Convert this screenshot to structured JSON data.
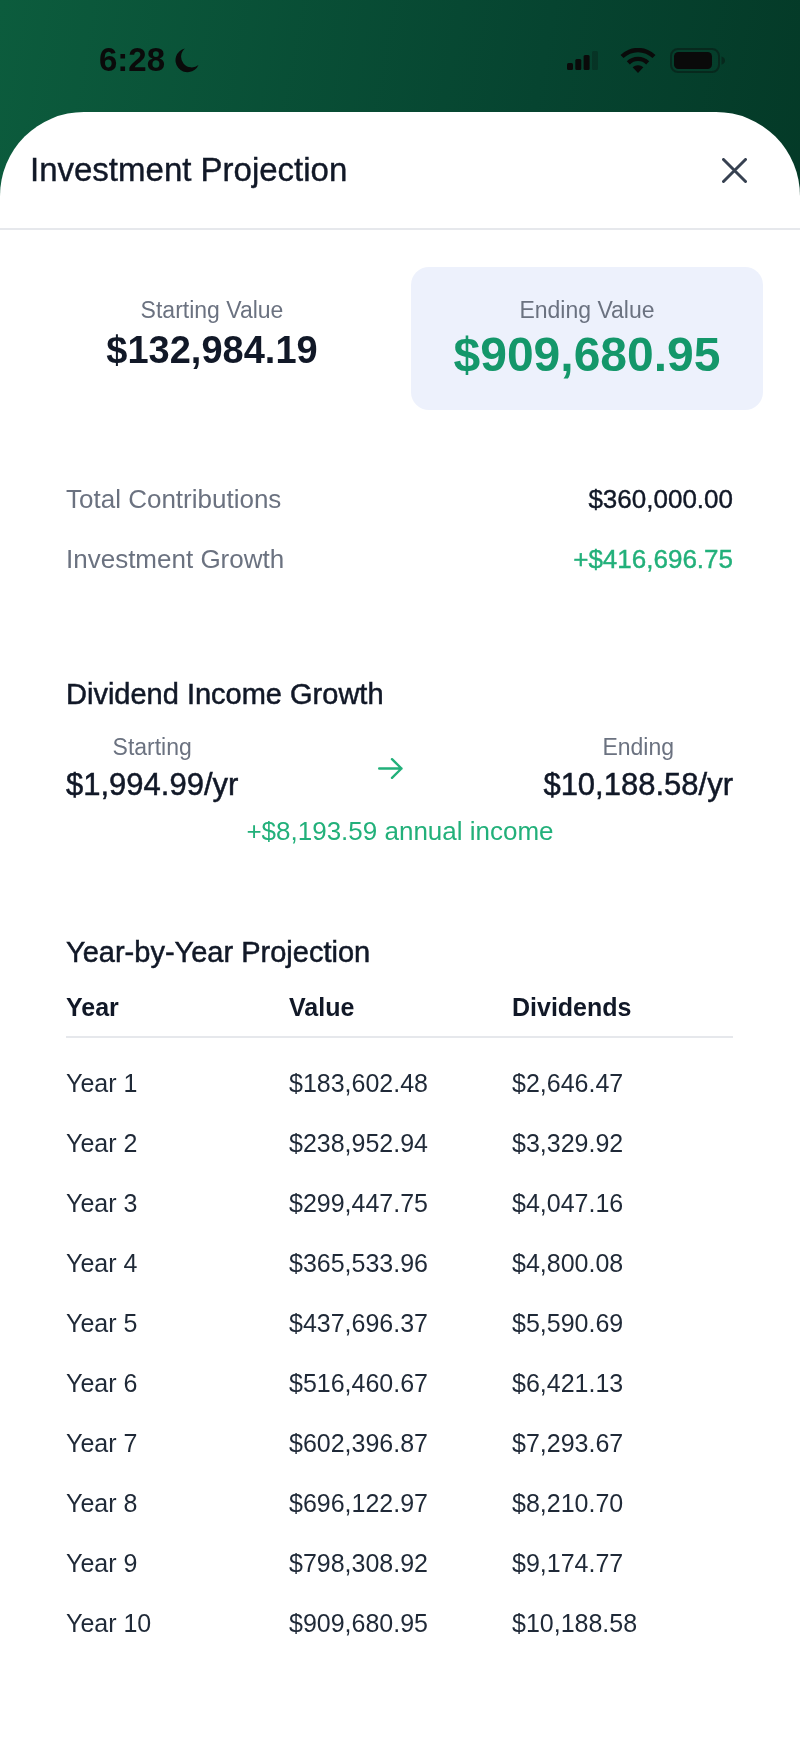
{
  "status_bar": {
    "time": "6:28"
  },
  "sheet": {
    "title": "Investment Projection"
  },
  "summary": [
    {
      "label": "Starting Value",
      "value": "$132,984.19",
      "highlighted": false
    },
    {
      "label": "Ending Value",
      "value": "$909,680.95",
      "highlighted": true
    }
  ],
  "totals": [
    {
      "label": "Total Contributions",
      "value": "$360,000.00",
      "kind": "amount"
    },
    {
      "label": "Investment Growth",
      "value": "+$416,696.75",
      "kind": "gain"
    }
  ],
  "dividend_income": {
    "title": "Dividend Income Growth",
    "starting": {
      "label": "Starting",
      "value": "$1,994.99/yr"
    },
    "ending": {
      "label": "Ending",
      "value": "$10,188.58/yr"
    },
    "change": "+$8,193.59 annual income"
  },
  "projection": {
    "title": "Year-by-Year Projection",
    "columns": [
      "Year",
      "Value",
      "Dividends"
    ],
    "rows": [
      [
        "Year 1",
        "$183,602.48",
        "$2,646.47"
      ],
      [
        "Year 2",
        "$238,952.94",
        "$3,329.92"
      ],
      [
        "Year 3",
        "$299,447.75",
        "$4,047.16"
      ],
      [
        "Year 4",
        "$365,533.96",
        "$4,800.08"
      ],
      [
        "Year 5",
        "$437,696.37",
        "$5,590.69"
      ],
      [
        "Year 6",
        "$516,460.67",
        "$6,421.13"
      ],
      [
        "Year 7",
        "$602,396.87",
        "$7,293.67"
      ],
      [
        "Year 8",
        "$696,122.97",
        "$8,210.70"
      ],
      [
        "Year 9",
        "$798,308.92",
        "$9,174.77"
      ],
      [
        "Year 10",
        "$909,680.95",
        "$10,188.58"
      ]
    ]
  }
}
